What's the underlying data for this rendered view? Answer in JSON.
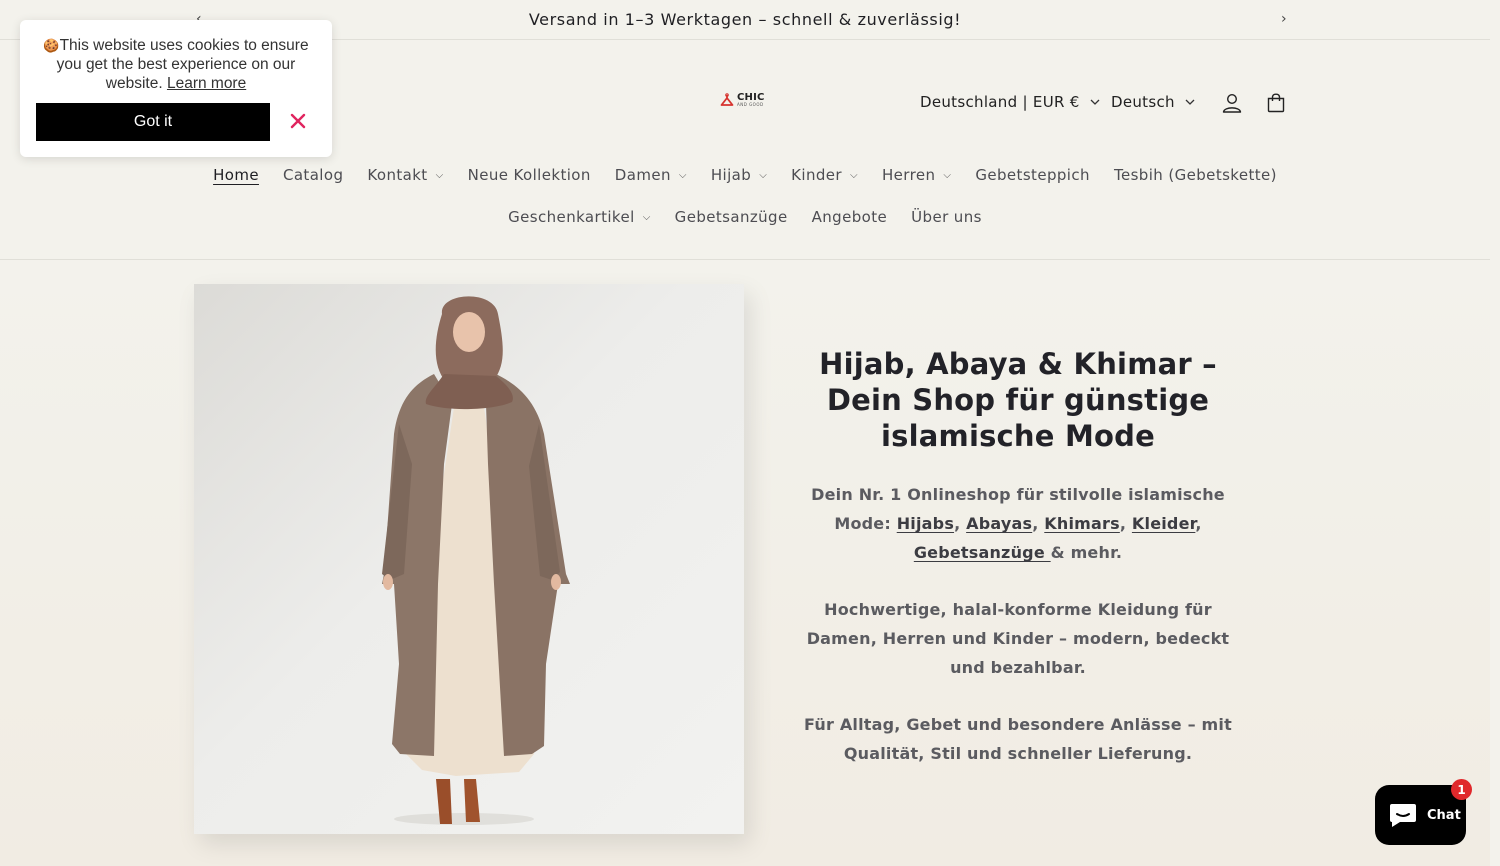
{
  "announcement": {
    "text": "Versand in 1–3 Werktagen – schnell & zuverlässig!"
  },
  "logo": {
    "main": "CHIC",
    "sub": "AND GOOD"
  },
  "header": {
    "country_label": "Deutschland | EUR €",
    "language_label": "Deutsch"
  },
  "nav": {
    "row1": [
      {
        "label": "Home"
      },
      {
        "label": "Catalog"
      },
      {
        "label": "Kontakt"
      },
      {
        "label": "Neue Kollektion"
      },
      {
        "label": "Damen"
      },
      {
        "label": "Hijab"
      },
      {
        "label": "Kinder"
      },
      {
        "label": "Herren"
      },
      {
        "label": "Gebetsteppich"
      },
      {
        "label": "Tesbih (Gebetskette)"
      }
    ],
    "row2": [
      {
        "label": "Geschenkartikel"
      },
      {
        "label": "Gebetsanzüge"
      },
      {
        "label": "Angebote"
      },
      {
        "label": "Über uns"
      }
    ]
  },
  "hero": {
    "title": "Hijab, Abaya & Khimar – Dein Shop für günstige islamische Mode",
    "para1_prefix": "Dein Nr. 1 Onlineshop für stilvolle islamische Mode: ",
    "links": [
      "Hijabs",
      "Abayas",
      "Khimars",
      "Kleider",
      "Gebetsanzüge "
    ],
    "sep1": ", ",
    "sep2": ", ",
    "sep3": ", ",
    "sep4": ",",
    "para1_suffix": "& mehr.",
    "para2": "Hochwertige, halal-konforme Kleidung für Damen, Herren und Kinder – modern, bedeckt und bezahlbar.",
    "para3": "Für Alltag, Gebet und besondere Anlässe – mit Qualität, Stil und schneller Lieferung."
  },
  "cookie": {
    "emoji": "🍪",
    "text": "This website uses cookies to ensure you get the best experience on our website.",
    "learn_more": "Learn more",
    "button": "Got it"
  },
  "chat": {
    "label": "Chat",
    "badge": "1"
  },
  "colors": {
    "background": "#f3f2ec",
    "close_x": "#e0245e",
    "badge": "#e0282b"
  }
}
